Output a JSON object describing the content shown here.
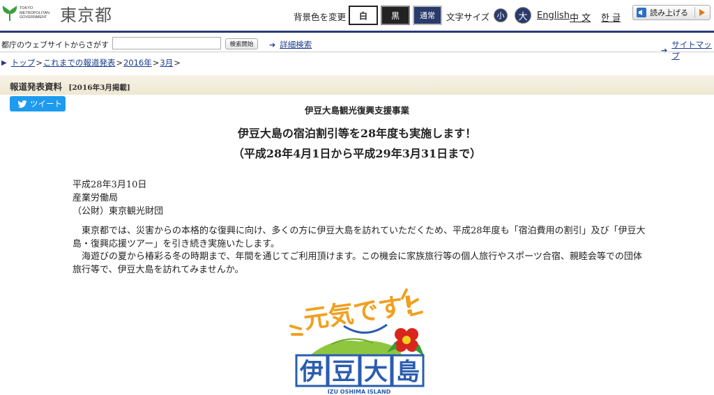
{
  "header": {
    "logo_en": "TOKYO METROPOLITAN GOVERNMENT",
    "logo_ja": "東京都",
    "bg_label": "背景色を変更",
    "bg_white": "白",
    "bg_black": "黒",
    "bg_normal": "通常",
    "font_label": "文字サイズ",
    "font_small": "小",
    "font_large": "大",
    "lang_en": "English",
    "lang_zh": "中 文",
    "lang_ko": "한 글",
    "read_aloud": "読み上げる"
  },
  "search": {
    "label": "都庁のウェブサイトからさがす",
    "value": "",
    "button": "検索開始",
    "advanced": "詳細検索",
    "sitemap": "サイトマップ"
  },
  "breadcrumb": {
    "top": "トップ",
    "releases": "これまでの報道発表",
    "year": "2016年",
    "month": "3月",
    "sep": ">"
  },
  "section": {
    "title": "報道発表資料",
    "date": "[2016年3月掲載]"
  },
  "tweet": {
    "label": "ツイート"
  },
  "article": {
    "category": "伊豆大島観光復興支援事業",
    "title": "伊豆大島の宿泊割引等を28年度も実施します！",
    "period": "（平成28年4月1日から平成29年3月31日まで）",
    "date": "平成28年3月10日",
    "bureau": "産業労働局",
    "foundation": "（公財）東京観光財団",
    "para1": "　東京都では、災害からの本格的な復興に向け、多くの方に伊豆大島を訪れていただくため、平成28年度も「宿泊費用の割引」及び「伊豆大島・復興応援ツアー」を引き続き実施いたします。",
    "para2": "　海遊びの夏から椿彩る冬の時期まで、年間を通じてご利用頂けます。この機会に家族旅行等の個人旅行やスポーツ合宿、親睦会等での団体旅行等で、伊豆大島を訪れてみませんか。"
  },
  "campaign_logo": {
    "slogan": "元気です!",
    "name": "伊豆大島",
    "name_en": "IZU OSHIMA ISLAND"
  },
  "colors": {
    "nav_blue": "#2a3a7a",
    "link": "#1a3b8c",
    "tweet": "#1d9bf0",
    "logo_orange": "#f0a020",
    "logo_blue": "#2a5db0"
  }
}
